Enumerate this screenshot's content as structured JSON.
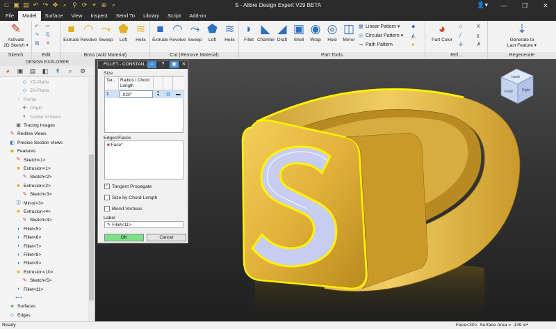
{
  "window": {
    "title": "S - Alibre Design Expert V29 BETA",
    "qat_icons": [
      "new-file-icon",
      "open-folder-icon",
      "save-icon",
      "undo-icon",
      "redo-icon",
      "pan-icon",
      "zoom-icon",
      "measure-icon",
      "repeat-icon",
      "tool-icon",
      "zoom-area-icon",
      "search-icon"
    ],
    "qat_glyphs": [
      "□",
      "▣",
      "▤",
      "↶",
      "↷",
      "✥",
      "⌕",
      "⚲",
      "⟳",
      "⌖",
      "⊕",
      "⌕"
    ],
    "user_glyph": "👤▾",
    "win_buttons": [
      "—",
      "❐",
      "✕"
    ]
  },
  "menu_tabs": [
    "File",
    "Model",
    "Surface",
    "View",
    "Inspect",
    "Send To",
    "Library",
    "Script",
    "Add-on"
  ],
  "active_tab": "Model",
  "ribbon": {
    "sketch": {
      "label": "Sketch",
      "activate_line1": "Activate",
      "activate_line2": "2D Sketch ▾"
    },
    "edit": {
      "label": "Edit"
    },
    "boss": {
      "label": "Boss (Add Material)",
      "items": [
        "Extrude",
        "Revolve",
        "Sweep",
        "Loft",
        "Helix"
      ]
    },
    "cut": {
      "label": "Cut (Remove Material)",
      "items": [
        "Extrude",
        "Revolve",
        "Sweep",
        "Loft",
        "Helix"
      ]
    },
    "part_tools": {
      "label": "Part Tools",
      "items": [
        "Fillet",
        "Chamfer",
        "Draft",
        "Shell",
        "Wrap",
        "Hole",
        "Mirror"
      ],
      "patterns": [
        "Linear Pattern ▾",
        "Circular Pattern ▾",
        "Path Pattern"
      ]
    },
    "ref": {
      "label": "Ref...",
      "part_color": "Part Color"
    },
    "regenerate": {
      "label": "Regenerate",
      "line1": "Generate to",
      "line2": "Last Feature ▾"
    }
  },
  "explorer": {
    "title": "DESIGN EXPLORER",
    "tree": [
      {
        "text": "YZ-Plane",
        "depth": 3,
        "dim": true,
        "icon": "plane-icon",
        "glyph": "◇"
      },
      {
        "text": "ZX-Plane",
        "depth": 3,
        "dim": true,
        "icon": "plane-icon",
        "glyph": "◇"
      },
      {
        "text": "Points",
        "depth": 2,
        "dim": true,
        "icon": "points-icon",
        "glyph": "⁘"
      },
      {
        "text": "Origin",
        "depth": 3,
        "dim": true,
        "icon": "origin-icon",
        "glyph": "✣"
      },
      {
        "text": "Center of Mass",
        "depth": 3,
        "dim": true,
        "icon": "center-of-mass-icon",
        "glyph": "◐"
      },
      {
        "text": "Tracing Images",
        "depth": 2,
        "dim": false,
        "icon": "image-icon",
        "glyph": "▣"
      },
      {
        "text": "Redline Views",
        "depth": 1,
        "dim": false,
        "icon": "redline-icon",
        "glyph": "✎"
      },
      {
        "text": "Precise Section Views",
        "depth": 1,
        "dim": false,
        "icon": "section-icon",
        "glyph": "◧"
      },
      {
        "text": "Features",
        "depth": 1,
        "dim": false,
        "icon": "features-icon",
        "glyph": "◆"
      },
      {
        "text": "Sketch<1>",
        "depth": 2,
        "dim": false,
        "icon": "sketch-icon",
        "glyph": "✎"
      },
      {
        "text": "Extrusion<1>",
        "depth": 2,
        "dim": false,
        "icon": "extrusion-icon",
        "glyph": "■"
      },
      {
        "text": "Sketch<2>",
        "depth": 3,
        "dim": false,
        "icon": "sketch-icon",
        "glyph": "✎"
      },
      {
        "text": "Extrusion<2>",
        "depth": 2,
        "dim": false,
        "icon": "extrusion-icon",
        "glyph": "■"
      },
      {
        "text": "Sketch<3>",
        "depth": 3,
        "dim": false,
        "icon": "sketch-icon",
        "glyph": "✎"
      },
      {
        "text": "Mirror<3>",
        "depth": 2,
        "dim": false,
        "icon": "mirror-icon",
        "glyph": "◫"
      },
      {
        "text": "Extrusion<4>",
        "depth": 2,
        "dim": false,
        "icon": "extrusion-icon",
        "glyph": "■"
      },
      {
        "text": "Sketch<4>",
        "depth": 3,
        "dim": false,
        "icon": "sketch-icon",
        "glyph": "✎"
      },
      {
        "text": "Fillet<5>",
        "depth": 2,
        "dim": false,
        "icon": "fillet-icon",
        "glyph": "◗"
      },
      {
        "text": "Fillet<6>",
        "depth": 2,
        "dim": false,
        "icon": "fillet-icon",
        "glyph": "◗"
      },
      {
        "text": "Fillet<7>",
        "depth": 2,
        "dim": false,
        "icon": "fillet-icon",
        "glyph": "◗"
      },
      {
        "text": "Fillet<8>",
        "depth": 2,
        "dim": false,
        "icon": "fillet-icon",
        "glyph": "◗"
      },
      {
        "text": "Fillet<9>",
        "depth": 2,
        "dim": false,
        "icon": "fillet-icon",
        "glyph": "◗"
      },
      {
        "text": "Extrusion<10>",
        "depth": 2,
        "dim": false,
        "icon": "extrusion-icon",
        "glyph": "■"
      },
      {
        "text": "Sketch<5>",
        "depth": 3,
        "dim": false,
        "icon": "sketch-icon",
        "glyph": "✎"
      },
      {
        "text": "Fillet<11>",
        "depth": 2,
        "dim": false,
        "icon": "fillet-icon",
        "glyph": "◗"
      },
      {
        "text": "",
        "depth": 2,
        "dim": false,
        "icon": "rollback-bar-icon",
        "glyph": "⟷"
      },
      {
        "text": "Surfaces",
        "depth": 1,
        "dim": false,
        "icon": "surfaces-icon",
        "glyph": "◈"
      },
      {
        "text": "Edges",
        "depth": 1,
        "dim": false,
        "icon": "edges-icon",
        "glyph": "◇"
      }
    ]
  },
  "dialog": {
    "title": "FILLET - CONSTAN...",
    "size_label": "Size",
    "col_target": "Tar...",
    "col_radius": "Radius / Chord Length",
    "row_index": "1",
    "row_value": ".020\"",
    "edges_label": "Edges/Faces",
    "edges_item": "Face*",
    "tangent": "Tangent Propagate",
    "tangent_checked": true,
    "chord": "Size by Chord Length",
    "chord_checked": false,
    "blend": "Blend Vertices",
    "blend_checked": false,
    "label_heading": "Label",
    "label_value": "Fillet<11>",
    "ok": "OK",
    "cancel": "Cancel"
  },
  "viewcube": {
    "top": "Isosh",
    "front": "Front",
    "right": "Right"
  },
  "status": {
    "left": "Ready",
    "right": "Face<30>: Surface Area = .139 in²"
  },
  "colors": {
    "gold": "#e8b83a",
    "highlight": "#fff200",
    "face_blue": "#c9cff0",
    "accent": "#2f6fc1"
  }
}
